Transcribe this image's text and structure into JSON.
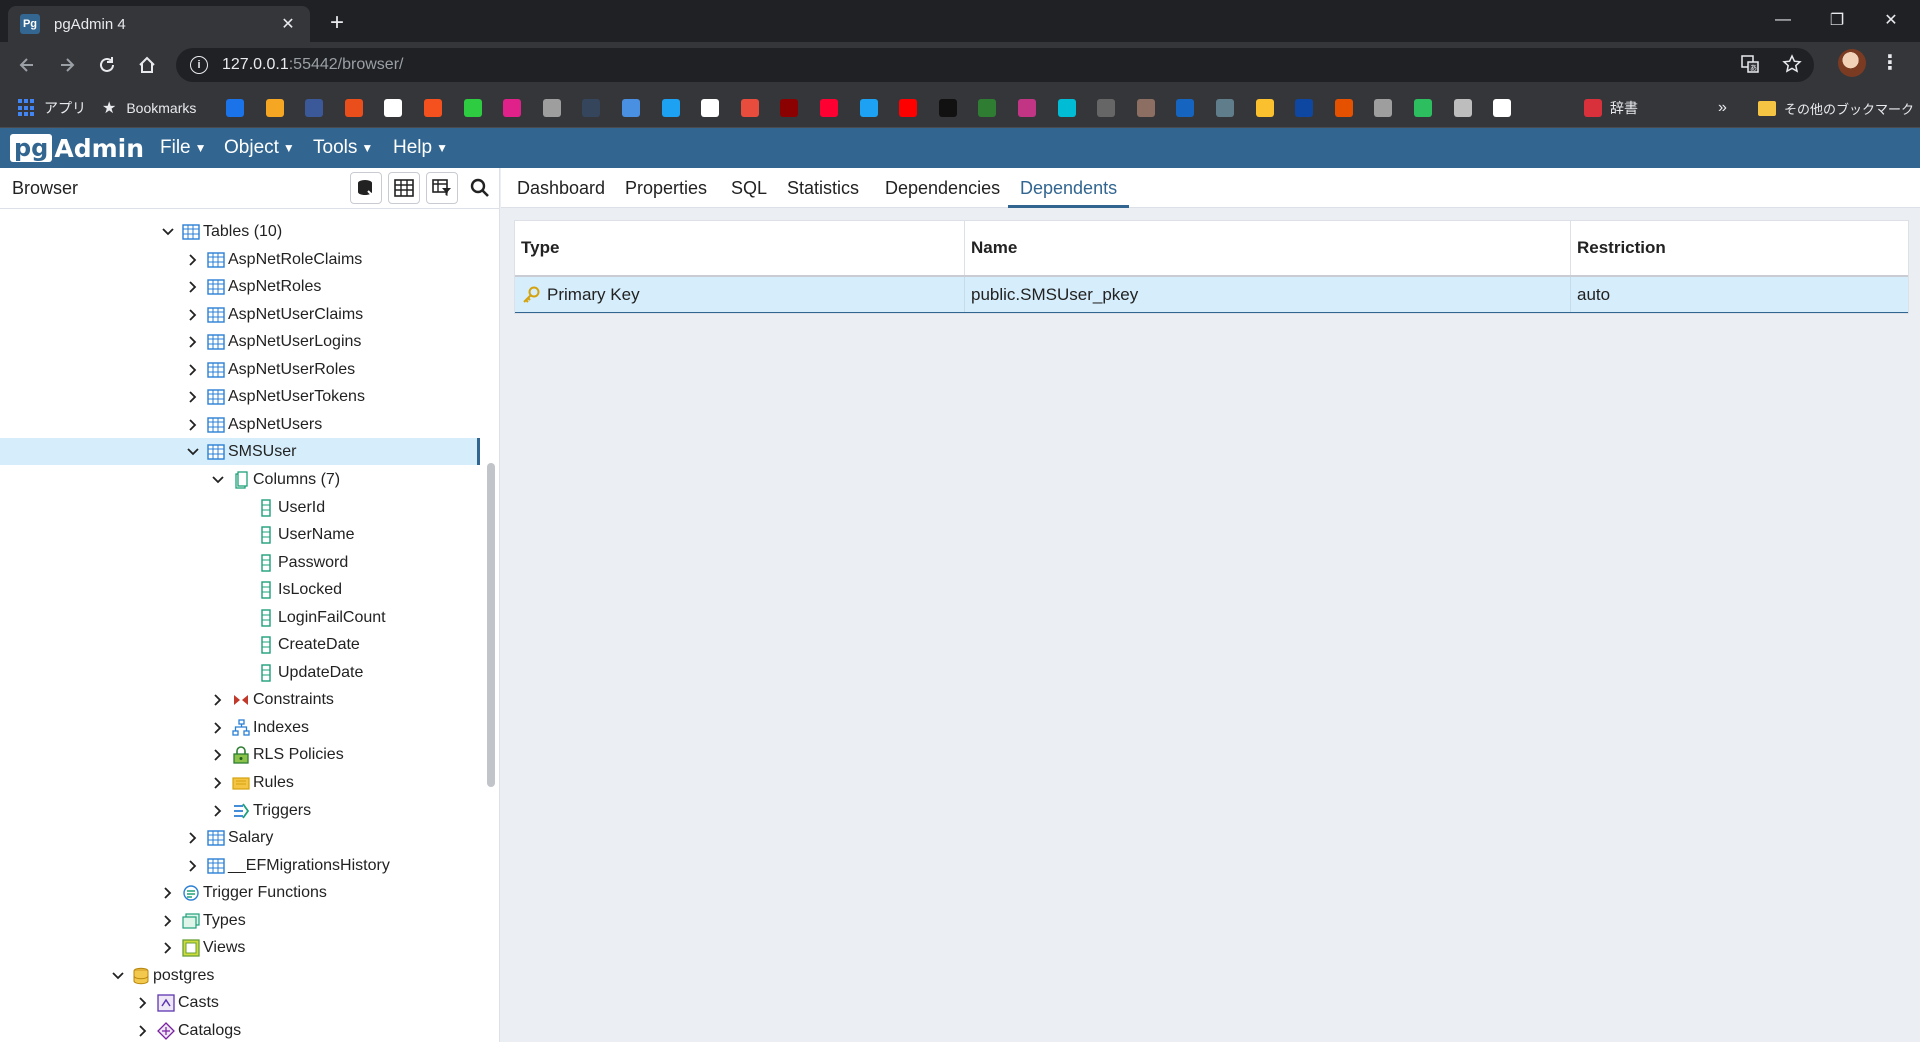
{
  "window": {
    "tab_title": "pgAdmin 4",
    "tab_favicon_text": "Pg",
    "new_tab": "+",
    "close_tab": "✕",
    "minimize": "—",
    "restore": "❐",
    "close": "✕"
  },
  "address_bar": {
    "url_host": "127.0.0.1",
    "url_rest": ":55442/browser/"
  },
  "bookmarks": {
    "apps_label": "アプリ",
    "bookmarks_label": "Bookmarks",
    "dictionary_label": "辞書",
    "overflow": "»",
    "other_label": "その他のブックマーク"
  },
  "pgadmin": {
    "logo_pg": "pg",
    "logo_admin": "Admin",
    "menus": [
      "File",
      "Object",
      "Tools",
      "Help"
    ]
  },
  "browser": {
    "title": "Browser",
    "tree": [
      {
        "label": "Tables (10)",
        "level": 0,
        "twisty": "open",
        "icon": "tables-icon"
      },
      {
        "label": "AspNetRoleClaims",
        "level": 1,
        "twisty": "closed",
        "icon": "table-icon"
      },
      {
        "label": "AspNetRoles",
        "level": 1,
        "twisty": "closed",
        "icon": "table-icon"
      },
      {
        "label": "AspNetUserClaims",
        "level": 1,
        "twisty": "closed",
        "icon": "table-icon"
      },
      {
        "label": "AspNetUserLogins",
        "level": 1,
        "twisty": "closed",
        "icon": "table-icon"
      },
      {
        "label": "AspNetUserRoles",
        "level": 1,
        "twisty": "closed",
        "icon": "table-icon"
      },
      {
        "label": "AspNetUserTokens",
        "level": 1,
        "twisty": "closed",
        "icon": "table-icon"
      },
      {
        "label": "AspNetUsers",
        "level": 1,
        "twisty": "closed",
        "icon": "table-icon"
      },
      {
        "label": "SMSUser",
        "level": 1,
        "twisty": "open",
        "icon": "table-icon",
        "selected": true
      },
      {
        "label": "Columns (7)",
        "level": 2,
        "twisty": "open",
        "icon": "columns-icon"
      },
      {
        "label": "UserId",
        "level": 3,
        "twisty": "none",
        "icon": "column-icon"
      },
      {
        "label": "UserName",
        "level": 3,
        "twisty": "none",
        "icon": "column-icon"
      },
      {
        "label": "Password",
        "level": 3,
        "twisty": "none",
        "icon": "column-icon"
      },
      {
        "label": "IsLocked",
        "level": 3,
        "twisty": "none",
        "icon": "column-icon"
      },
      {
        "label": "LoginFailCount",
        "level": 3,
        "twisty": "none",
        "icon": "column-icon"
      },
      {
        "label": "CreateDate",
        "level": 3,
        "twisty": "none",
        "icon": "column-icon"
      },
      {
        "label": "UpdateDate",
        "level": 3,
        "twisty": "none",
        "icon": "column-icon"
      },
      {
        "label": "Constraints",
        "level": 2,
        "twisty": "closed",
        "icon": "constraints-icon"
      },
      {
        "label": "Indexes",
        "level": 2,
        "twisty": "closed",
        "icon": "indexes-icon"
      },
      {
        "label": "RLS Policies",
        "level": 2,
        "twisty": "closed",
        "icon": "rls-policies-icon"
      },
      {
        "label": "Rules",
        "level": 2,
        "twisty": "closed",
        "icon": "rules-icon"
      },
      {
        "label": "Triggers",
        "level": 2,
        "twisty": "closed",
        "icon": "triggers-icon"
      },
      {
        "label": "Salary",
        "level": 1,
        "twisty": "closed",
        "icon": "table-icon"
      },
      {
        "label": "__EFMigrationsHistory",
        "level": 1,
        "twisty": "closed",
        "icon": "table-icon"
      },
      {
        "label": "Trigger Functions",
        "level": 0,
        "twisty": "closed",
        "icon": "trigger-functions-icon"
      },
      {
        "label": "Types",
        "level": 0,
        "twisty": "closed",
        "icon": "types-icon"
      },
      {
        "label": "Views",
        "level": 0,
        "twisty": "closed",
        "icon": "views-icon"
      },
      {
        "label": "postgres",
        "level": -2,
        "twisty": "open",
        "icon": "database-icon"
      },
      {
        "label": "Casts",
        "level": -1,
        "twisty": "closed",
        "icon": "casts-icon"
      },
      {
        "label": "Catalogs",
        "level": -1,
        "twisty": "closed",
        "icon": "catalogs-icon"
      }
    ]
  },
  "tabs": [
    "Dashboard",
    "Properties",
    "SQL",
    "Statistics",
    "Dependencies",
    "Dependents"
  ],
  "active_tab": "Dependents",
  "dependents_table": {
    "columns": [
      "Type",
      "Name",
      "Restriction"
    ],
    "rows": [
      {
        "type": "Primary Key",
        "name": "public.SMSUser_pkey",
        "restriction": "auto",
        "icon": "key-icon"
      }
    ]
  },
  "colors": {
    "pg_header": "#326690",
    "selection": "#d6eefc",
    "chrome_dark": "#202124"
  }
}
